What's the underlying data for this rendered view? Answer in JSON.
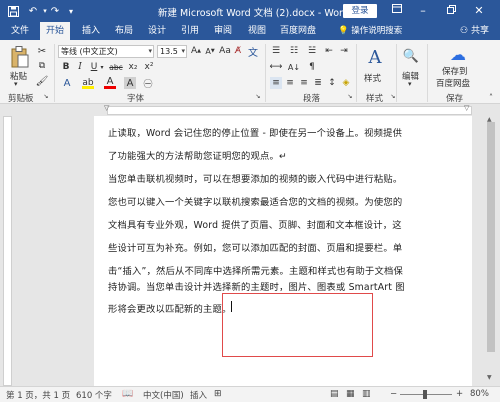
{
  "titlebar": {
    "title": "新建 Microsoft Word 文档 (2).docx  -  Word",
    "login": "登录",
    "save_icon": "save-icon",
    "undo_icon": "undo-icon",
    "redo_icon": "redo-icon"
  },
  "tabs": [
    "文件",
    "开始",
    "插入",
    "布局",
    "设计",
    "引用",
    "审阅",
    "视图",
    "百度网盘"
  ],
  "tell_me": "操作说明搜索",
  "share": "共享",
  "ribbon": {
    "paste": "粘贴",
    "font_name": "等线 (中文正文)",
    "font_size": "13.5",
    "bold": "B",
    "italic": "I",
    "underline": "U",
    "strike": "abc",
    "sub": "x₂",
    "sup": "x²",
    "style_btn": "样式",
    "edit_btn": "编辑",
    "save_baidu_line1": "保存到",
    "save_baidu_line2": "百度网盘",
    "groups": {
      "clipboard": "剪贴板",
      "font": "字体",
      "paragraph": "段落",
      "styles": "样式",
      "save": "保存"
    }
  },
  "document": {
    "lines": [
      "止读取，Word 会记住您的停止位置 - 即使在另一个设备上。视频提供",
      "了功能强大的方法帮助您证明您的观点。↵",
      "当您单击联机视频时，可以在想要添加的视频的嵌入代码中进行粘贴。",
      "您也可以键入一个关键字以联机搜索最适合您的文档的视频。为使您的",
      "文档具有专业外观，Word 提供了页眉、页脚、封面和文本框设计，这",
      "些设计可互为补充。例如，您可以添加匹配的封面、页眉和提要栏。单",
      "击“插入”，然后从不同库中选择所需元素。主题和样式也有助于文档保",
      "持协调。当您单击设计并选择新的主题时，图片、图表或 SmartArt 图",
      "形将会更改以匹配新的主题。"
    ]
  },
  "status": {
    "page": "第 1 页，共 1 页",
    "words": "610 个字",
    "language": "中文(中国)",
    "insert": "插入",
    "zoom": "80%"
  },
  "colors": {
    "title_bar": "#2b579a",
    "ribbon_bg": "#f3f3f3",
    "highlight_rect": "#e04a4a"
  }
}
